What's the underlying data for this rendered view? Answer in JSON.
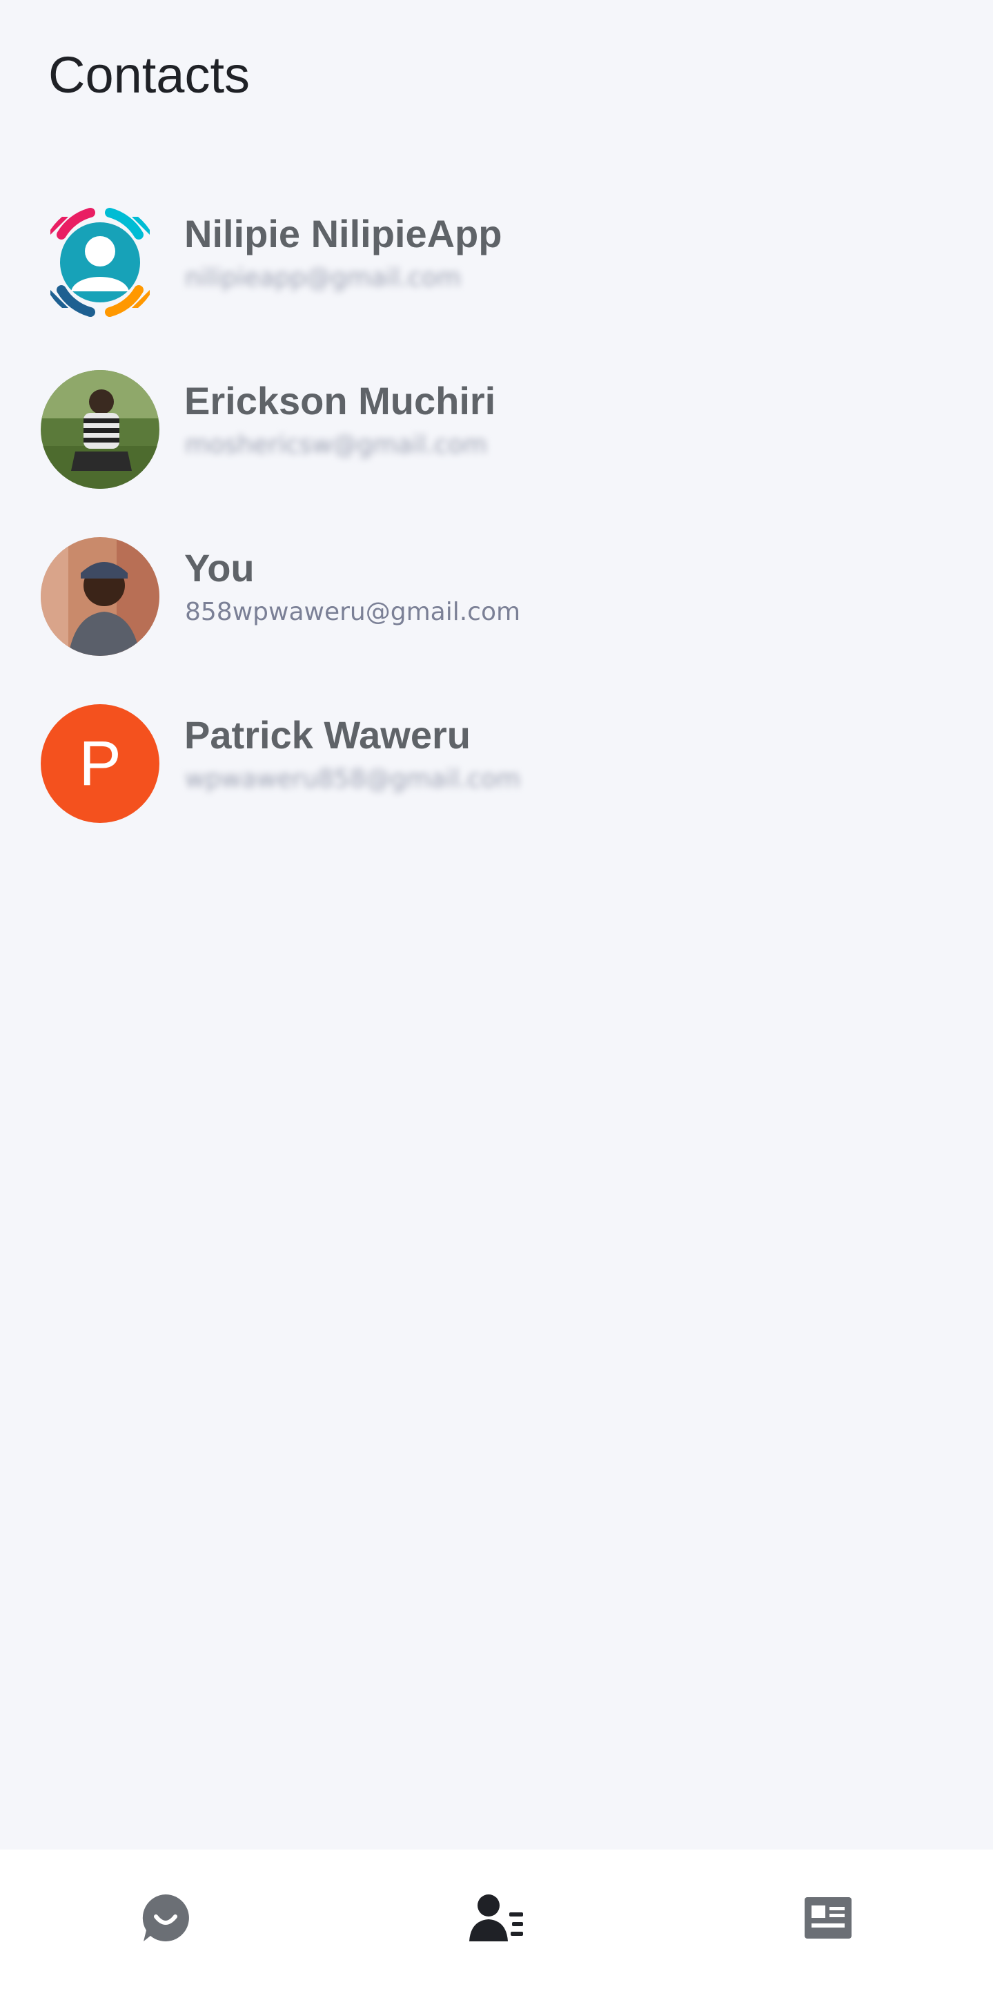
{
  "header": {
    "title": "Contacts"
  },
  "contacts": [
    {
      "name": "Nilipie NilipieApp",
      "email": "nilipieapp@gmail.com",
      "email_blurred": true,
      "avatar": "nilipie-logo-icon"
    },
    {
      "name": "Erickson Muchiri",
      "email": "moshericsw@gmail.com",
      "email_blurred": true,
      "avatar": "photo"
    },
    {
      "name": "You",
      "email": "858wpwaweru@gmail.com",
      "email_blurred": false,
      "avatar": "photo"
    },
    {
      "name": "Patrick Waweru",
      "email": "wpwaweru858@gmail.com",
      "email_blurred": true,
      "avatar_letter": "P",
      "avatar_color": "#f4511e"
    }
  ],
  "bottom_nav": {
    "items": [
      {
        "icon": "chat-bubble-icon",
        "active": false
      },
      {
        "icon": "contacts-icon",
        "active": true
      },
      {
        "icon": "newspaper-icon",
        "active": false
      }
    ]
  },
  "colors": {
    "background": "#f5f6fa",
    "title_text": "#1f2126",
    "name_text": "#5f6368",
    "email_text": "#7b8096",
    "nav_inactive": "#6b6f75",
    "nav_active": "#1f2126",
    "letter_avatar": "#f4511e"
  }
}
